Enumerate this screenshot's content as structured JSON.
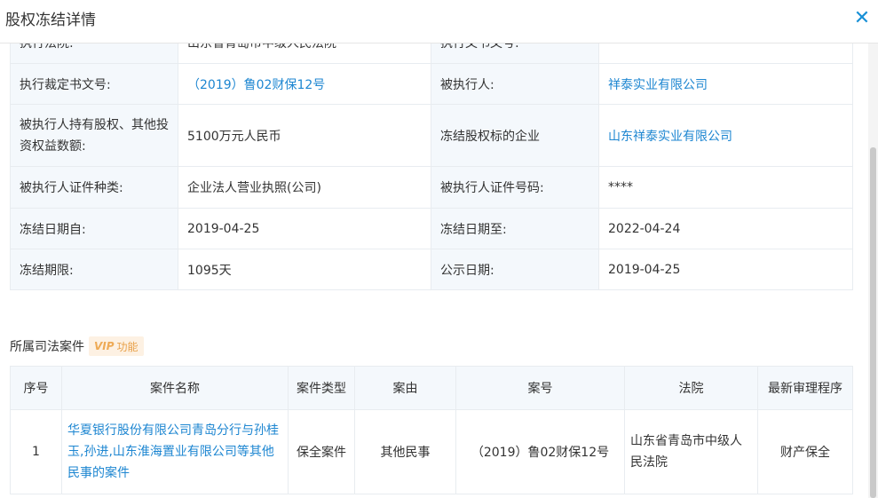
{
  "dialog": {
    "title": "股权冻结详情",
    "close_symbol": "✕"
  },
  "details": [
    [
      "执行法院:",
      "山东省青岛市中级人民法院",
      "执行文书文号:",
      "-"
    ],
    [
      "执行裁定书文号:",
      "（2019）鲁02财保12号",
      "被执行人:",
      "祥泰实业有限公司"
    ],
    [
      "被执行人持有股权、其他投资权益数额:",
      "5100万元人民币",
      "冻结股权标的企业",
      "山东祥泰实业有限公司"
    ],
    [
      "被执行人证件种类:",
      "企业法人营业执照(公司)",
      "被执行人证件号码:",
      "****"
    ],
    [
      "冻结日期自:",
      "2019-04-25",
      "冻结日期至:",
      "2022-04-24"
    ],
    [
      "冻结期限:",
      "1095天",
      "公示日期:",
      "2019-04-25"
    ]
  ],
  "section": {
    "title": "所属司法案件",
    "vip_tag": "VIP",
    "vip_text": "功能"
  },
  "cases_table": {
    "headers": [
      "序号",
      "案件名称",
      "案件类型",
      "案由",
      "案号",
      "法院",
      "最新审理程序"
    ],
    "rows": [
      [
        "1",
        "华夏银行股份有限公司青岛分行与孙桂玉,孙进,山东淮海置业有限公司等其他民事的案件",
        "保全案件",
        "其他民事",
        "（2019）鲁02财保12号",
        "山东省青岛市中级人民法院",
        "财产保全"
      ]
    ]
  },
  "colors": {
    "accent": "#1890d6",
    "link": "#1d86d1",
    "label_bg": "#f4f8fc",
    "vip_bg": "#fdf1e3",
    "vip_text": "#e8a048"
  }
}
